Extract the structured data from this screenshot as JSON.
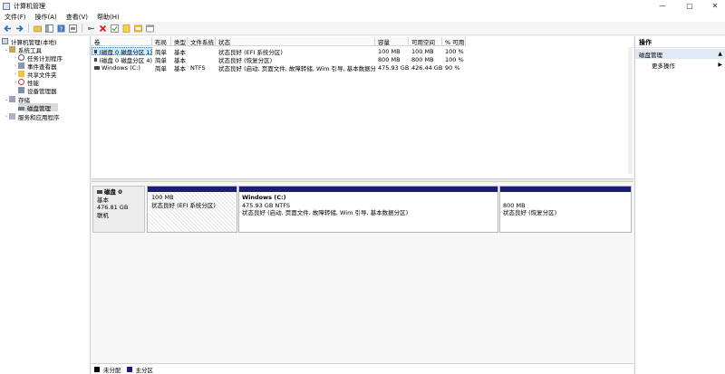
{
  "window": {
    "title": "计算机管理",
    "controls": {
      "minimize": "—",
      "maximize": "▢",
      "close": "✕"
    }
  },
  "menu": [
    "文件(F)",
    "操作(A)",
    "查看(V)",
    "帮助(H)"
  ],
  "toolbar": [
    "back-icon",
    "forward-icon",
    "up-folder-icon",
    "show-hide-tree-icon",
    "help-icon",
    "properties-icon",
    "connect-icon",
    "delete-icon",
    "check-icon",
    "new-icon",
    "export-icon",
    "view-icon"
  ],
  "tree": {
    "root": "计算机管理(本地)",
    "system_tools": "系统工具",
    "task_scheduler": "任务计划程序",
    "event_viewer": "事件查看器",
    "shared_folders": "共享文件夹",
    "performance": "性能",
    "device_manager": "设备管理器",
    "storage": "存储",
    "disk_management": "磁盘管理",
    "services_apps": "服务和应用程序"
  },
  "volumes": {
    "columns": [
      "卷",
      "布局",
      "类型",
      "文件系统",
      "状态",
      "容量",
      "可用空间",
      "% 可用"
    ],
    "rows": [
      [
        "(磁盘 0 磁盘分区 1)",
        "简单",
        "基本",
        "",
        "状态良好 (EFI 系统分区)",
        "100 MB",
        "100 MB",
        "100 %"
      ],
      [
        "(磁盘 0 磁盘分区 4)",
        "简单",
        "基本",
        "",
        "状态良好 (恢复分区)",
        "800 MB",
        "800 MB",
        "100 %"
      ],
      [
        "Windows (C:)",
        "简单",
        "基本",
        "NTFS",
        "状态良好 (启动, 页面文件, 故障转储, Wim 引导, 基本数据分区)",
        "475.93 GB",
        "426.44 GB",
        "90 %"
      ]
    ]
  },
  "disk": {
    "name": "磁盘 0",
    "type": "基本",
    "size": "476.81 GB",
    "status": "联机",
    "partitions": [
      {
        "title": "",
        "size": "100 MB",
        "status": "状态良好 (EFI 系统分区)"
      },
      {
        "title": "Windows  (C:)",
        "size": "475.93 GB NTFS",
        "status": "状态良好 (启动, 页面文件, 故障转储, Wim 引导, 基本数据分区)"
      },
      {
        "title": "",
        "size": "800 MB",
        "status": "状态良好 (恢复分区)"
      }
    ]
  },
  "legend": [
    {
      "label": "未分配",
      "color": "#000000"
    },
    {
      "label": "主分区",
      "color": "#1c1c7a"
    }
  ],
  "actions": {
    "header": "操作",
    "section": "磁盘管理",
    "more": "更多操作"
  }
}
